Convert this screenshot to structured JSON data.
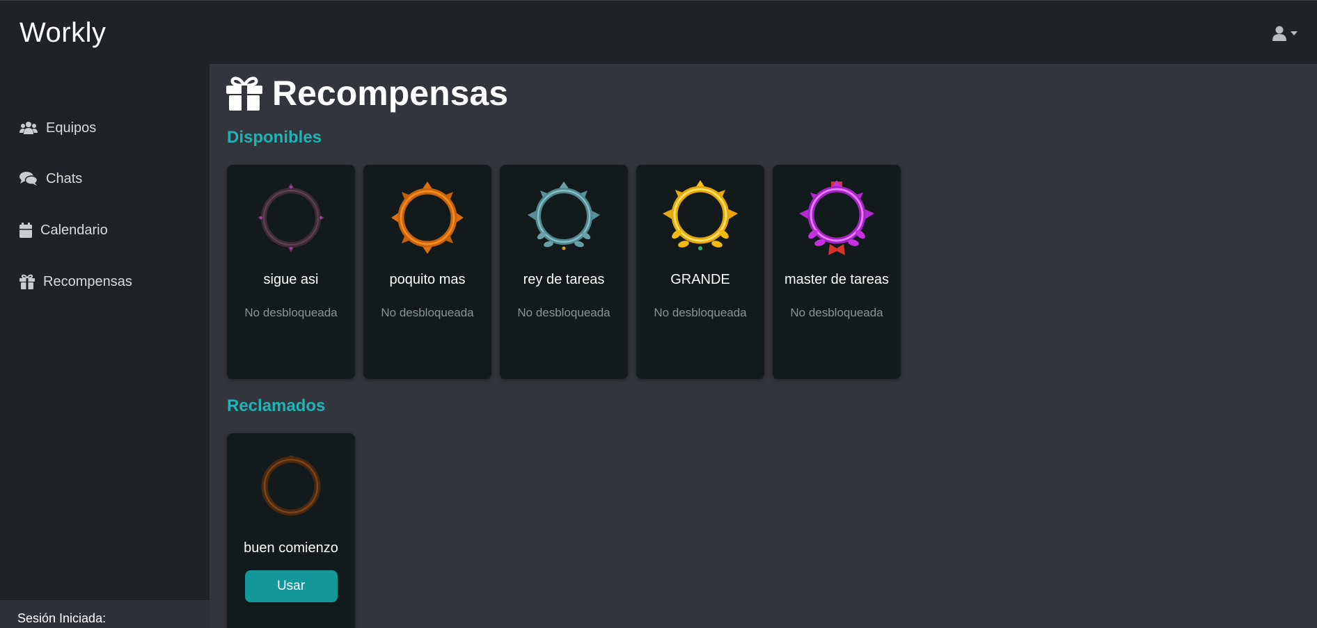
{
  "app": {
    "brand": "Workly"
  },
  "header": {
    "user_icon": "user-icon",
    "menu_icon": "caret-down-icon"
  },
  "sidebar": {
    "items": [
      {
        "label": "Equipos",
        "icon": "users-icon"
      },
      {
        "label": "Chats",
        "icon": "comments-icon"
      },
      {
        "label": "Calendario",
        "icon": "calendar-icon"
      },
      {
        "label": "Recompensas",
        "icon": "gift-icon"
      }
    ],
    "session_label": "Sesión Iniciada:"
  },
  "page": {
    "title": "Recompensas",
    "title_icon": "gift-icon",
    "available_title": "Disponibles",
    "claimed_title": "Reclamados"
  },
  "available": [
    {
      "name": "sigue asi",
      "status": "No desbloqueada",
      "badge": "dark-ring-badge",
      "color": "#5a3a4a"
    },
    {
      "name": "poquito mas",
      "status": "No desbloqueada",
      "badge": "orange-star-badge",
      "color": "#d6700e"
    },
    {
      "name": "rey de tareas",
      "status": "No desbloqueada",
      "badge": "teal-laurel-badge",
      "color": "#6aa0a8"
    },
    {
      "name": "GRANDE",
      "status": "No desbloqueada",
      "badge": "gold-laurel-badge",
      "color": "#f2b90f"
    },
    {
      "name": "master de tareas",
      "status": "No desbloqueada",
      "badge": "purple-ribbon-badge",
      "color": "#c531e0"
    }
  ],
  "claimed": [
    {
      "name": "buen comienzo",
      "button": "Usar",
      "badge": "bronze-ring-badge",
      "color": "#6b3a12"
    }
  ],
  "colors": {
    "accent": "#1fb3b5",
    "button": "#13979a",
    "main_bg": "#32353b",
    "sidebar_bg": "#1f2226",
    "card_bg": "#131a1c"
  }
}
